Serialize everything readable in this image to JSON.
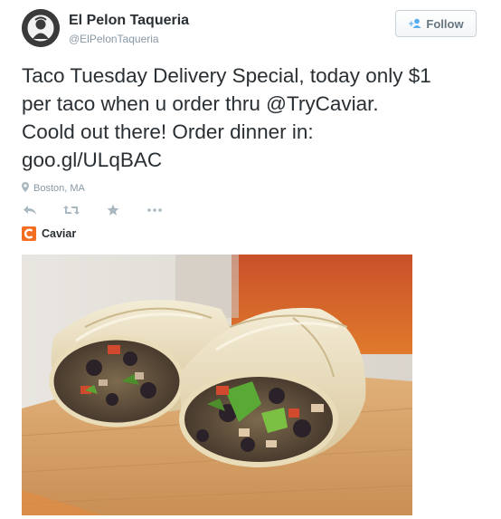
{
  "tweet": {
    "author": {
      "name": "El Pelon Taqueria",
      "handle": "@ElPelonTaqueria",
      "avatar_ring_text": "EL PELON"
    },
    "follow_label": "Follow",
    "text_lines": [
      "Taco Tuesday Delivery Special, today only $1",
      "per taco when u order thru @TryCaviar.",
      "Coold out there! Order dinner in:",
      "goo.gl/ULqBAC"
    ],
    "location": "Boston, MA",
    "actions": [
      "reply-icon",
      "retweet-icon",
      "favorite-icon",
      "more-icon"
    ],
    "card": {
      "source_label": "Caviar",
      "brand_color": "#f26d21"
    }
  },
  "colors": {
    "text": "#292f33",
    "muted": "#8899a6",
    "icon": "#aab8c2",
    "follow_icon": "#55acee"
  }
}
